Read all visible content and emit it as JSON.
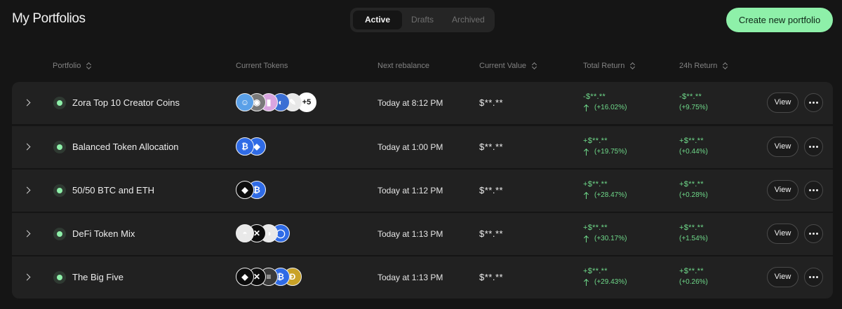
{
  "page_title": "My Portfolios",
  "tabs": [
    {
      "label": "Active"
    },
    {
      "label": "Drafts"
    },
    {
      "label": "Archived"
    }
  ],
  "create_button": "Create new portfolio",
  "columns": {
    "portfolio": "Portfolio",
    "current_tokens": "Current Tokens",
    "next_rebalance": "Next rebalance",
    "current_value": "Current Value",
    "total_return": "Total Return",
    "return_24h": "24h Return"
  },
  "colors": {
    "accent": "#8ef0a9",
    "positive": "#6fd98a",
    "row_bg": "#212121",
    "page_bg": "#151515"
  },
  "rows": [
    {
      "name": "Zora Top 10 Creator Coins",
      "tokens": [
        {
          "icon": "creator-coin-1-icon",
          "glyph": "☺",
          "bg": "#5aa0e8"
        },
        {
          "icon": "creator-coin-2-icon",
          "glyph": "◉",
          "bg": "#7a7a7a"
        },
        {
          "icon": "creator-coin-3-icon",
          "glyph": "▮",
          "bg": "#d9a5e0"
        },
        {
          "icon": "creator-coin-4-icon",
          "glyph": "◐",
          "bg": "#3b6fd4"
        },
        {
          "icon": "creator-coin-5-icon",
          "glyph": "✎",
          "bg": "#e8e8e8"
        }
      ],
      "more_count": "+5",
      "next_rebalance": "Today at 8:12 PM",
      "current_value": "$**.**",
      "total_return": "-$**.**",
      "total_return_pct": "(+16.02%)",
      "return_24h": "-$**.**",
      "return_24h_pct": "(+9.75%)",
      "view_label": "View"
    },
    {
      "name": "Balanced Token Allocation",
      "tokens": [
        {
          "icon": "bitcoin-icon",
          "glyph": "₿",
          "bg": "#2f6be6"
        },
        {
          "icon": "ethereum-icon",
          "glyph": "◆",
          "bg": "#2f6be6"
        }
      ],
      "more_count": "",
      "next_rebalance": "Today at 1:00 PM",
      "current_value": "$**.**",
      "total_return": "+$**.**",
      "total_return_pct": "(+19.75%)",
      "return_24h": "+$**.**",
      "return_24h_pct": "(+0.44%)",
      "view_label": "View"
    },
    {
      "name": "50/50 BTC and ETH",
      "tokens": [
        {
          "icon": "ethereum-icon",
          "glyph": "◆",
          "bg": "#0d0d0d"
        },
        {
          "icon": "bitcoin-icon",
          "glyph": "₿",
          "bg": "#2f6be6"
        }
      ],
      "more_count": "",
      "next_rebalance": "Today at 1:12 PM",
      "current_value": "$**.**",
      "total_return": "+$**.**",
      "total_return_pct": "(+28.47%)",
      "return_24h": "+$**.**",
      "return_24h_pct": "(+0.28%)",
      "view_label": "View"
    },
    {
      "name": "DeFi Token Mix",
      "tokens": [
        {
          "icon": "defi-token-1-icon",
          "glyph": "◓",
          "bg": "#e9e9e9"
        },
        {
          "icon": "defi-token-2-icon",
          "glyph": "✕",
          "bg": "#0d0d0d"
        },
        {
          "icon": "defi-token-3-icon",
          "glyph": "◑",
          "bg": "#e9e9e9"
        },
        {
          "icon": "defi-token-4-icon",
          "glyph": "◯",
          "bg": "#2f6be6"
        }
      ],
      "more_count": "",
      "next_rebalance": "Today at 1:13 PM",
      "current_value": "$**.**",
      "total_return": "+$**.**",
      "total_return_pct": "(+30.17%)",
      "return_24h": "+$**.**",
      "return_24h_pct": "(+1.54%)",
      "view_label": "View"
    },
    {
      "name": "The Big Five",
      "tokens": [
        {
          "icon": "ethereum-icon",
          "glyph": "◆",
          "bg": "#0d0d0d"
        },
        {
          "icon": "xrp-icon",
          "glyph": "✕",
          "bg": "#0d0d0d"
        },
        {
          "icon": "solana-icon",
          "glyph": "≡",
          "bg": "#3a3a3a"
        },
        {
          "icon": "bitcoin-icon",
          "glyph": "₿",
          "bg": "#2f6be6"
        },
        {
          "icon": "dogecoin-icon",
          "glyph": "Ð",
          "bg": "#c9a227"
        }
      ],
      "more_count": "",
      "next_rebalance": "Today at 1:13 PM",
      "current_value": "$**.**",
      "total_return": "+$**.**",
      "total_return_pct": "(+29.43%)",
      "return_24h": "+$**.**",
      "return_24h_pct": "(+0.26%)",
      "view_label": "View"
    }
  ]
}
